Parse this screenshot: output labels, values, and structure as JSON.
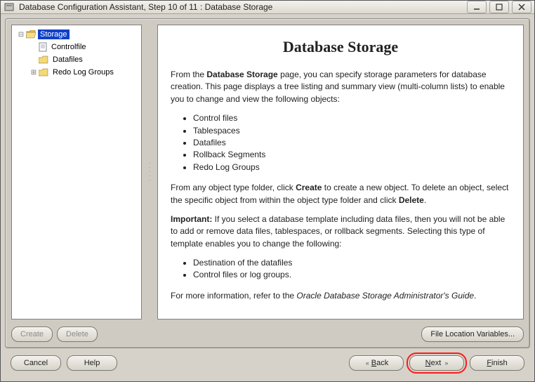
{
  "window": {
    "title": "Database Configuration Assistant, Step 10 of 11 : Database Storage"
  },
  "tree": {
    "root": "Storage",
    "children": [
      "Controlfile",
      "Datafiles",
      "Redo Log Groups"
    ]
  },
  "page": {
    "heading": "Database Storage",
    "intro_pre": "From the ",
    "intro_bold": "Database Storage",
    "intro_post": " page, you can specify storage parameters for database creation. This page displays a tree listing and summary view (multi-column lists) to enable you to change and view the following objects:",
    "objects": [
      "Control files",
      "Tablespaces",
      "Datafiles",
      "Rollback Segments",
      "Redo Log Groups"
    ],
    "para2_a": "From any object type folder, click ",
    "para2_create": "Create",
    "para2_b": " to create a new object. To delete an object, select the specific object from within the object type folder and click ",
    "para2_delete": "Delete",
    "para2_c": ".",
    "important_label": "Important:",
    "important_text": " If you select a database template including data files, then you will not be able to add or remove data files, tablespaces, or rollback segments. Selecting this type of template enables you to change the following:",
    "template_items": [
      "Destination of the datafiles",
      "Control files or log groups."
    ],
    "moreinfo_a": "For more information, refer to the ",
    "moreinfo_i": "Oracle Database Storage Administrator's Guide",
    "moreinfo_b": "."
  },
  "buttons": {
    "create": "Create",
    "delete": "Delete",
    "file_loc": "File Location Variables...",
    "cancel": "Cancel",
    "help": "Help",
    "back": "Back",
    "next": "Next",
    "finish": "Finish"
  }
}
